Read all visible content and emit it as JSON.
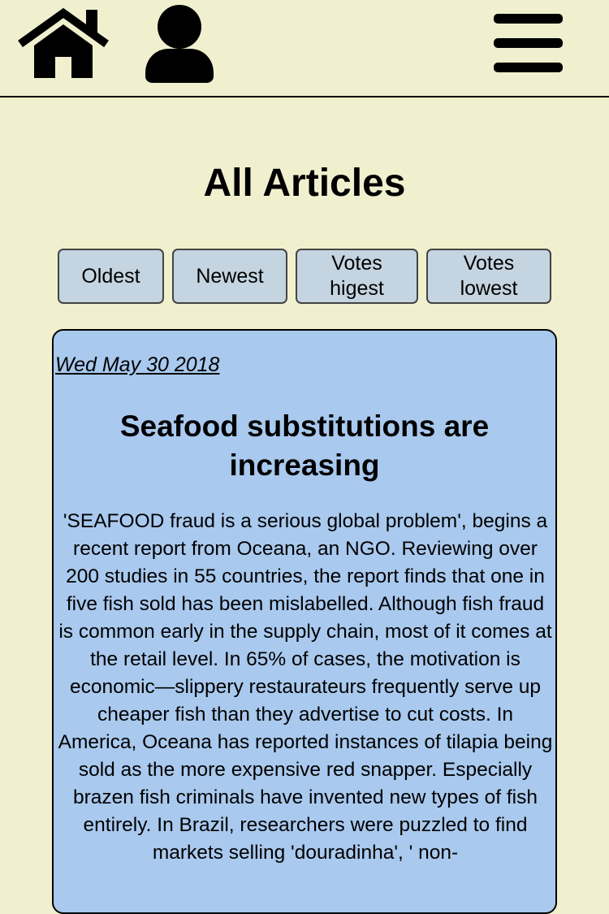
{
  "nav": {
    "home_icon": "home-icon",
    "profile_icon": "user-icon",
    "menu_icon": "hamburger-menu-icon"
  },
  "page": {
    "title": "All Articles"
  },
  "sort_buttons": {
    "oldest": "Oldest",
    "newest": "Newest",
    "votes_highest": "Votes\nhigest",
    "votes_lowest": "Votes\nlowest"
  },
  "article": {
    "date": "Wed May 30 2018",
    "title": "Seafood substitutions are increasing",
    "body": "'SEAFOOD fraud is a serious global problem', begins a recent report from Oceana, an NGO. Reviewing over 200 studies in 55 countries, the report finds that one in five fish sold has been mislabelled. Although fish fraud is common early in the supply chain, most of it comes at the retail level. In 65% of cases, the motivation is economic—slippery restaurateurs frequently serve up cheaper fish than they advertise to cut costs. In America, Oceana has reported instances of tilapia being sold as the more expensive red snapper. Especially brazen fish criminals have invented new types of fish entirely. In Brazil, researchers were puzzled to find markets selling 'douradinha', ' non-"
  },
  "colors": {
    "background": "#f0f0cf",
    "button_bg": "#c4d4e0",
    "card_bg": "#a9c9ee"
  }
}
